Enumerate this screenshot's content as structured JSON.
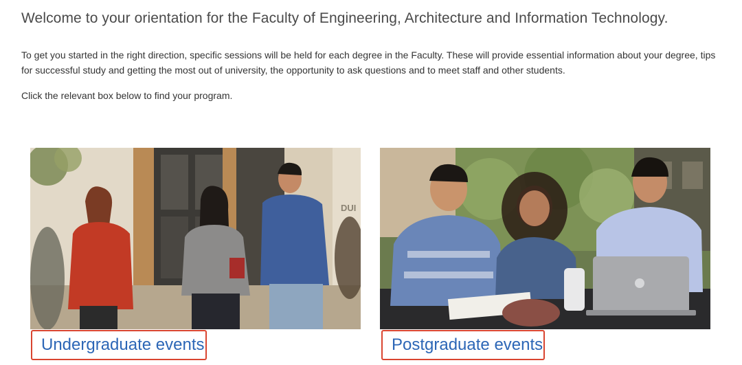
{
  "header": {
    "title": "Welcome to your orientation for the Faculty of Engineering, Architecture and Information Technology."
  },
  "content": {
    "intro": "To get you started in the right direction, specific sessions will be held for each degree in the Faculty. These will provide essential information about your degree, tips for successful study and getting the most out of university, the opportunity to ask questions and to meet staff and other students.",
    "instruction": "Click the relevant box below to find your program."
  },
  "cards": [
    {
      "label": "Undergraduate events",
      "image": "students-walking-campus-photo"
    },
    {
      "label": "Postgraduate events",
      "image": "students-studying-laptop-photo"
    }
  ],
  "colors": {
    "link": "#2c66b6",
    "highlight_border": "#d9442f",
    "heading": "#4a4a4a",
    "body_text": "#333333"
  }
}
